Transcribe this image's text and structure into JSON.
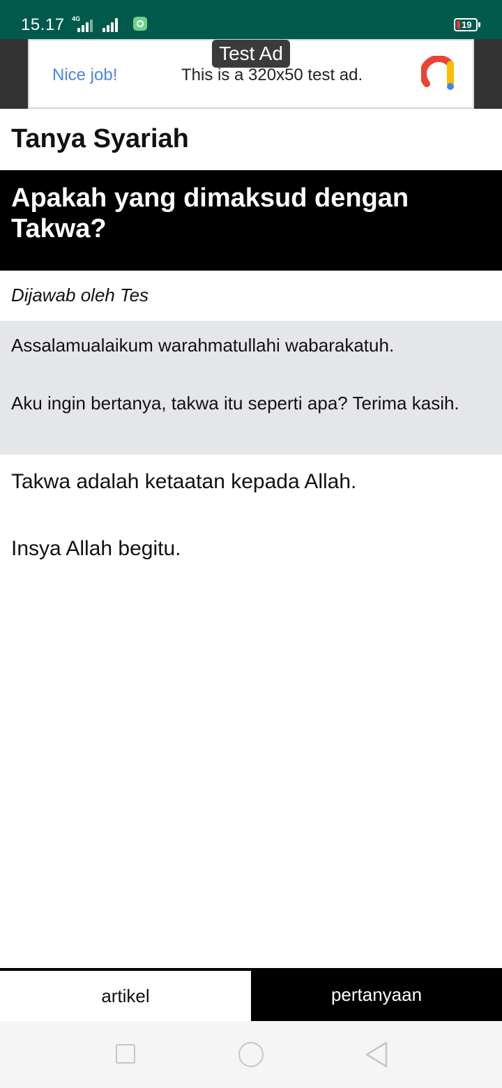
{
  "status_bar": {
    "time": "15.17",
    "network": "4G",
    "battery": "19",
    "background_color": "#005a4c"
  },
  "ad": {
    "label": "Test Ad",
    "headline": "Nice job!",
    "body": "This is a 320x50 test ad.",
    "logo_icon": "admob-logo-icon"
  },
  "app": {
    "title": "Tanya Syariah"
  },
  "question": {
    "title": "Apakah yang dimaksud dengan Takwa?",
    "answered_by": "Dijawab oleh Tes",
    "greeting": "Assalamualaikum warahmatullahi wabarakatuh.",
    "body": "Aku ingin bertanya, takwa itu seperti apa? Terima kasih."
  },
  "answer": {
    "line1": "Takwa adalah ketaatan kepada Allah.",
    "line2": "Insya Allah begitu."
  },
  "tabs": [
    {
      "label": "artikel",
      "active": false
    },
    {
      "label": "pertanyaan",
      "active": true
    }
  ],
  "nav": {
    "recent_icon": "square-icon",
    "home_icon": "circle-icon",
    "back_icon": "triangle-back-icon"
  }
}
